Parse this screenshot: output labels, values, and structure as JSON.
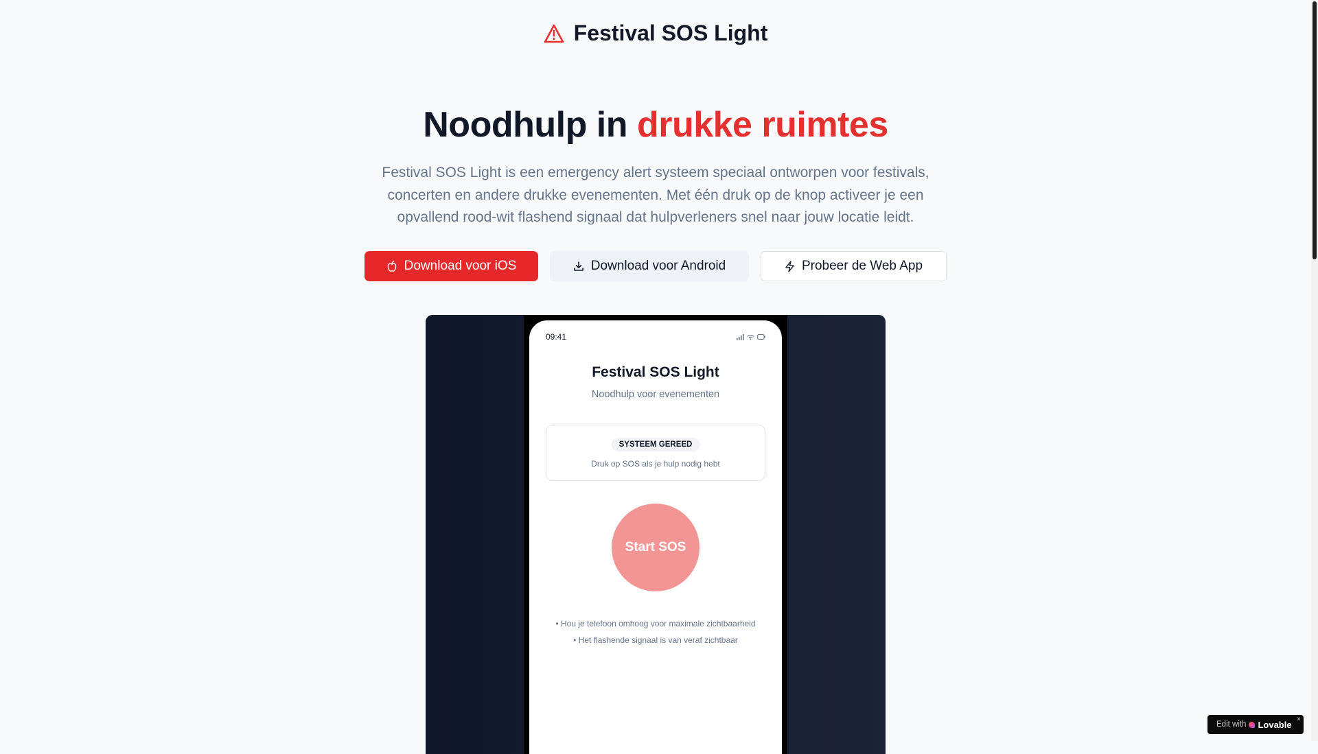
{
  "header": {
    "brand_title": "Festival SOS Light",
    "icon": "alert-triangle-icon"
  },
  "hero": {
    "title_part1": "Noodhulp in ",
    "title_accent": "drukke ruimtes",
    "description": "Festival SOS Light is een emergency alert systeem speciaal ontworpen voor festivals, concerten en andere drukke evenementen. Met één druk op de knop activeer je een opvallend rood-wit flashend signaal dat hulpverleners snel naar jouw locatie leidt."
  },
  "actions": {
    "ios_label": "Download voor iOS",
    "android_label": "Download voor Android",
    "web_label": "Probeer de Web App"
  },
  "phone": {
    "time": "09:41",
    "app_title": "Festival SOS Light",
    "app_subtitle": "Noodhulp voor evenementen",
    "status_badge": "SYSTEEM GEREED",
    "status_hint": "Druk op SOS als je hulp nodig hebt",
    "sos_label": "Start SOS",
    "tips": [
      "• Hou je telefoon omhoog voor maximale zichtbaarheid",
      "• Het flashende signaal is van veraf zichtbaar"
    ]
  },
  "badge": {
    "prefix": "Edit with",
    "name": "Lovable",
    "close": "×"
  },
  "colors": {
    "accent": "#e53030",
    "ios_button": "#e5292b",
    "sos_button": "#f29594",
    "device_bg": "#0f172a"
  }
}
